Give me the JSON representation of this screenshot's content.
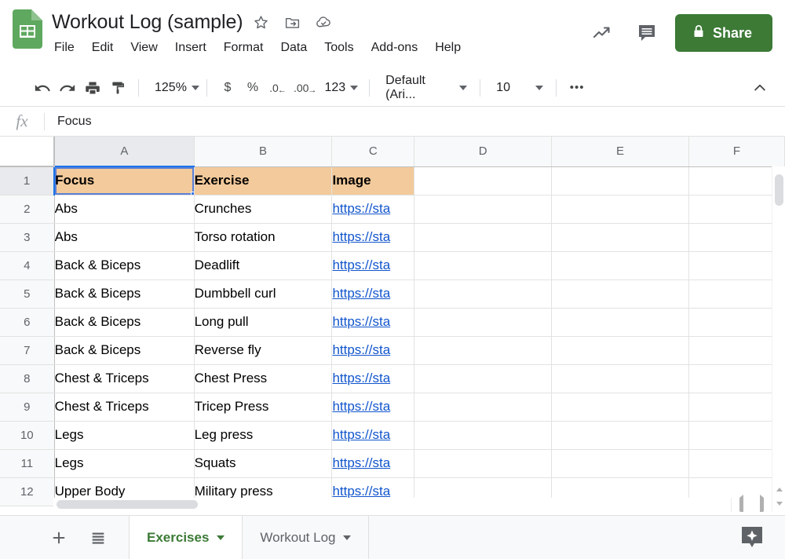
{
  "app": {
    "logo_icon": "sheets-logo-icon",
    "title": "Workout Log (sample)",
    "title_icons": [
      {
        "name": "star-icon",
        "label": "Star"
      },
      {
        "name": "move-to-folder-icon",
        "label": "Move"
      },
      {
        "name": "cloud-saved-icon",
        "label": "Saved to Drive"
      }
    ],
    "menu": [
      "File",
      "Edit",
      "View",
      "Insert",
      "Format",
      "Data",
      "Tools",
      "Add-ons",
      "Help"
    ],
    "right_icons": [
      {
        "name": "explore-trend-icon",
        "label": "Activity"
      },
      {
        "name": "comment-icon",
        "label": "Comments"
      }
    ],
    "share_label": "Share",
    "share_lock_icon": "lock-icon",
    "share_color": "#3c7a36"
  },
  "toolbar": {
    "undo_icon": "undo-icon",
    "redo_icon": "redo-icon",
    "print_icon": "print-icon",
    "paint_icon": "paint-format-icon",
    "zoom_value": "125%",
    "currency_label": "$",
    "percent_label": "%",
    "decrease_decimal_label": ".0",
    "increase_decimal_label": ".00",
    "formats_label": "123",
    "font_value": "Default (Ari...",
    "fontsize_value": "10",
    "more_label": "•••",
    "collapse_icon": "chevron-up-icon"
  },
  "formula_bar": {
    "fx_label": "fx",
    "value": "Focus",
    "placeholder": ""
  },
  "grid": {
    "columns": [
      "A",
      "B",
      "C",
      "D",
      "E",
      "F"
    ],
    "selected_column": "A",
    "selected_row": 1,
    "selected_cell": "A1",
    "header_fill": "#f3ca9b",
    "link_color": "#1155cc",
    "rows": [
      {
        "n": 1,
        "header": true,
        "cells": [
          "Focus",
          "Exercise",
          "Image",
          "",
          "",
          ""
        ]
      },
      {
        "n": 2,
        "header": false,
        "cells": [
          "Abs",
          "Crunches",
          "https://sta",
          "",
          "",
          ""
        ]
      },
      {
        "n": 3,
        "header": false,
        "cells": [
          "Abs",
          "Torso rotation",
          "https://sta",
          "",
          "",
          ""
        ]
      },
      {
        "n": 4,
        "header": false,
        "cells": [
          "Back & Biceps",
          "Deadlift",
          "https://sta",
          "",
          "",
          ""
        ]
      },
      {
        "n": 5,
        "header": false,
        "cells": [
          "Back & Biceps",
          "Dumbbell curl",
          "https://sta",
          "",
          "",
          ""
        ]
      },
      {
        "n": 6,
        "header": false,
        "cells": [
          "Back & Biceps",
          "Long pull",
          "https://sta",
          "",
          "",
          ""
        ]
      },
      {
        "n": 7,
        "header": false,
        "cells": [
          "Back & Biceps",
          "Reverse fly",
          "https://sta",
          "",
          "",
          ""
        ]
      },
      {
        "n": 8,
        "header": false,
        "cells": [
          "Chest & Triceps",
          "Chest Press",
          "https://sta",
          "",
          "",
          ""
        ]
      },
      {
        "n": 9,
        "header": false,
        "cells": [
          "Chest & Triceps",
          "Tricep Press",
          "https://sta",
          "",
          "",
          ""
        ]
      },
      {
        "n": 10,
        "header": false,
        "cells": [
          "Legs",
          "Leg press",
          "https://sta",
          "",
          "",
          ""
        ]
      },
      {
        "n": 11,
        "header": false,
        "cells": [
          "Legs",
          "Squats",
          "https://sta",
          "",
          "",
          ""
        ]
      },
      {
        "n": 12,
        "header": false,
        "cells": [
          "Upper Body",
          "Military press",
          "https://sta",
          "",
          "",
          ""
        ]
      }
    ]
  },
  "sheetbar": {
    "add_sheet_icon": "plus-icon",
    "all_sheets_icon": "list-icon",
    "tabs": [
      {
        "label": "Exercises",
        "active": true
      },
      {
        "label": "Workout Log",
        "active": false
      }
    ],
    "explore_icon": "explore-star-icon",
    "active_tab_color": "#3c7a36"
  }
}
